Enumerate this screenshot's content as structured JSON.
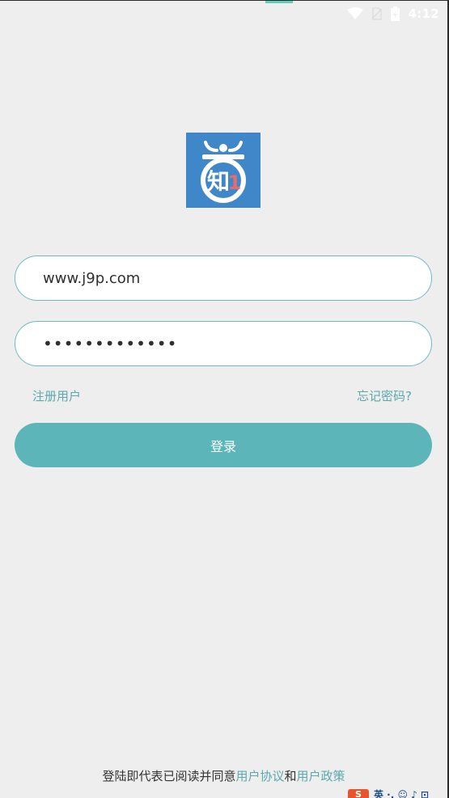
{
  "status_bar": {
    "time": "4:12",
    "icons": [
      "wifi-icon",
      "no-sim-icon",
      "battery-icon"
    ]
  },
  "logo": {
    "brand_color": "#3f87c8",
    "glyph": "知",
    "numeral": "1",
    "numeral_color": "#e86b6b"
  },
  "login_form": {
    "username_value": "www.j9p.com",
    "password_value": "•••••••••••••",
    "register_label": "注册用户",
    "forgot_label": "忘记密码?",
    "login_label": "登录"
  },
  "agreement": {
    "prefix": "登陆即代表已阅读并同意",
    "user_agreement": "用户协议",
    "conjunction": "和",
    "user_policy": "用户政策"
  },
  "ime": {
    "logo": "S",
    "text": "英 ·, ☺ ♪ ⊡"
  },
  "colors": {
    "background": "#eeeeee",
    "accent": "#5cb5b8",
    "link": "#5aa9ac",
    "field_border": "#6cbcbf"
  }
}
